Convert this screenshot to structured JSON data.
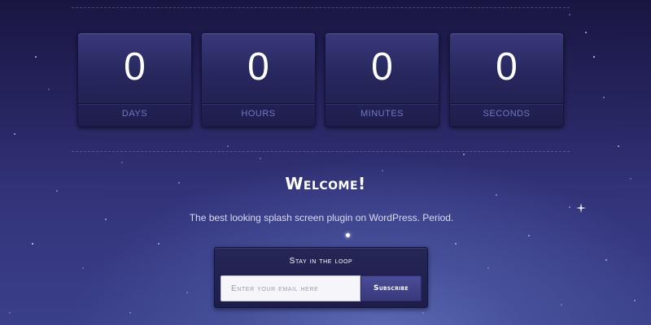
{
  "countdown": [
    {
      "value": "0",
      "label": "Days"
    },
    {
      "value": "0",
      "label": "Hours"
    },
    {
      "value": "0",
      "label": "Minutes"
    },
    {
      "value": "0",
      "label": "Seconds"
    }
  ],
  "welcome": {
    "heading": "Welcome!",
    "tagline": "The best looking splash screen plugin on WordPress. Period."
  },
  "subscribe": {
    "title": "Stay in the loop",
    "email_placeholder": "Enter your email here",
    "button_label": "Subscribe"
  },
  "colors": {
    "background": "#2b2b6a",
    "counter_label": "#6f78c4",
    "text": "#ffffff"
  }
}
